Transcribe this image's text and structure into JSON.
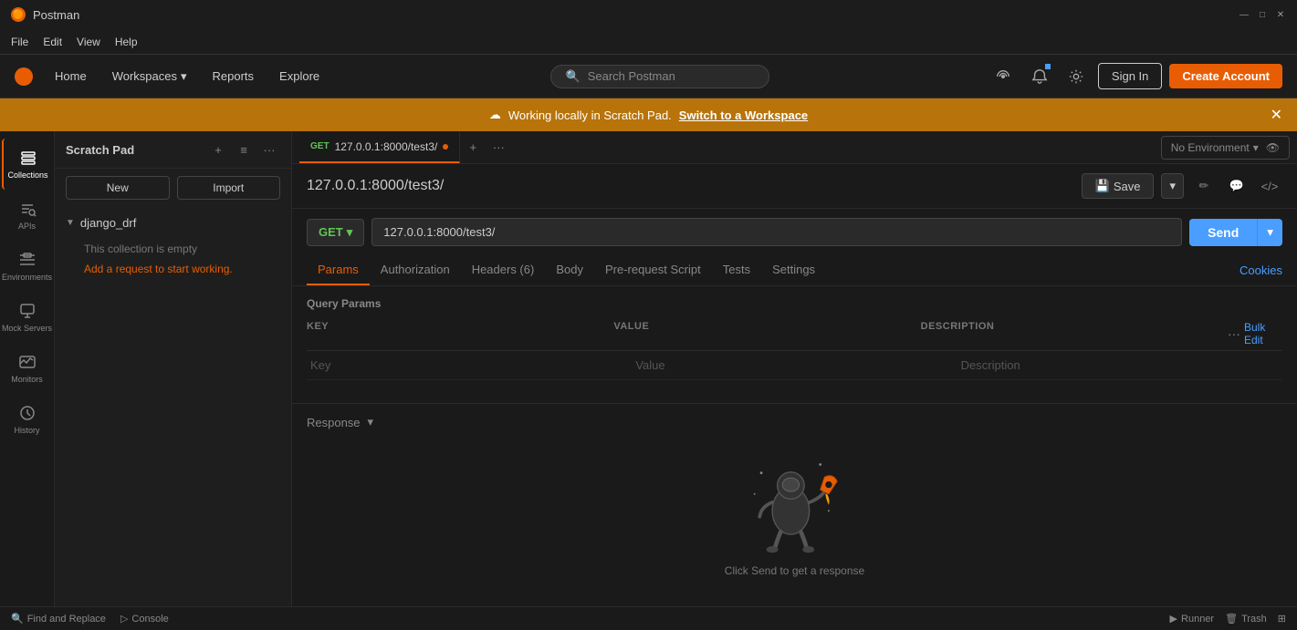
{
  "app": {
    "title": "Postman",
    "icon": "🟠"
  },
  "titlebar": {
    "minimize": "—",
    "maximize": "□",
    "close": "✕"
  },
  "menubar": {
    "items": [
      "File",
      "Edit",
      "View",
      "Help"
    ]
  },
  "topnav": {
    "home": "Home",
    "workspaces": "Workspaces",
    "reports": "Reports",
    "explore": "Explore",
    "search_placeholder": "Search Postman",
    "sign_in": "Sign In",
    "create_account": "Create Account"
  },
  "banner": {
    "message": "Working locally in Scratch Pad.",
    "cta": "Switch to a Workspace"
  },
  "sidebar": {
    "items": [
      {
        "id": "collections",
        "label": "Collections",
        "icon": "collections"
      },
      {
        "id": "apis",
        "label": "APIs",
        "icon": "apis"
      },
      {
        "id": "environments",
        "label": "Environments",
        "icon": "environments"
      },
      {
        "id": "mock-servers",
        "label": "Mock Servers",
        "icon": "mock"
      },
      {
        "id": "monitors",
        "label": "Monitors",
        "icon": "monitors"
      },
      {
        "id": "history",
        "label": "History",
        "icon": "history"
      }
    ]
  },
  "scratch_pad": {
    "title": "Scratch Pad",
    "new_btn": "New",
    "import_btn": "Import"
  },
  "collections": {
    "django_drf": {
      "name": "django_drf",
      "empty_message": "This collection is empty",
      "add_request_text": "Add a request",
      "add_request_suffix": " to start working."
    }
  },
  "tabs": [
    {
      "method": "GET",
      "url": "127.0.0.1:8000/test3/",
      "has_dot": true,
      "active": true
    }
  ],
  "request": {
    "title": "127.0.0.1:8000/test3/",
    "method": "GET",
    "url": "127.0.0.1:8000/test3/",
    "save_label": "Save",
    "environment": "No Environment",
    "send_label": "Send"
  },
  "request_tabs": [
    {
      "id": "params",
      "label": "Params",
      "active": true
    },
    {
      "id": "authorization",
      "label": "Authorization",
      "active": false
    },
    {
      "id": "headers",
      "label": "Headers (6)",
      "active": false
    },
    {
      "id": "body",
      "label": "Body",
      "active": false
    },
    {
      "id": "pre-request-script",
      "label": "Pre-request Script",
      "active": false
    },
    {
      "id": "tests",
      "label": "Tests",
      "active": false
    },
    {
      "id": "settings",
      "label": "Settings",
      "active": false
    }
  ],
  "cookies_link": "Cookies",
  "query_params": {
    "section_title": "Query Params",
    "columns": {
      "key": "KEY",
      "value": "VALUE",
      "description": "DESCRIPTION"
    },
    "bulk_edit": "Bulk Edit",
    "key_placeholder": "Key",
    "value_placeholder": "Value",
    "description_placeholder": "Description"
  },
  "response": {
    "title": "Response",
    "empty_hint": "Click Send to get a response"
  },
  "bottom_bar": {
    "find_replace": "Find and Replace",
    "console": "Console",
    "runner": "Runner",
    "trash": "Trash"
  }
}
